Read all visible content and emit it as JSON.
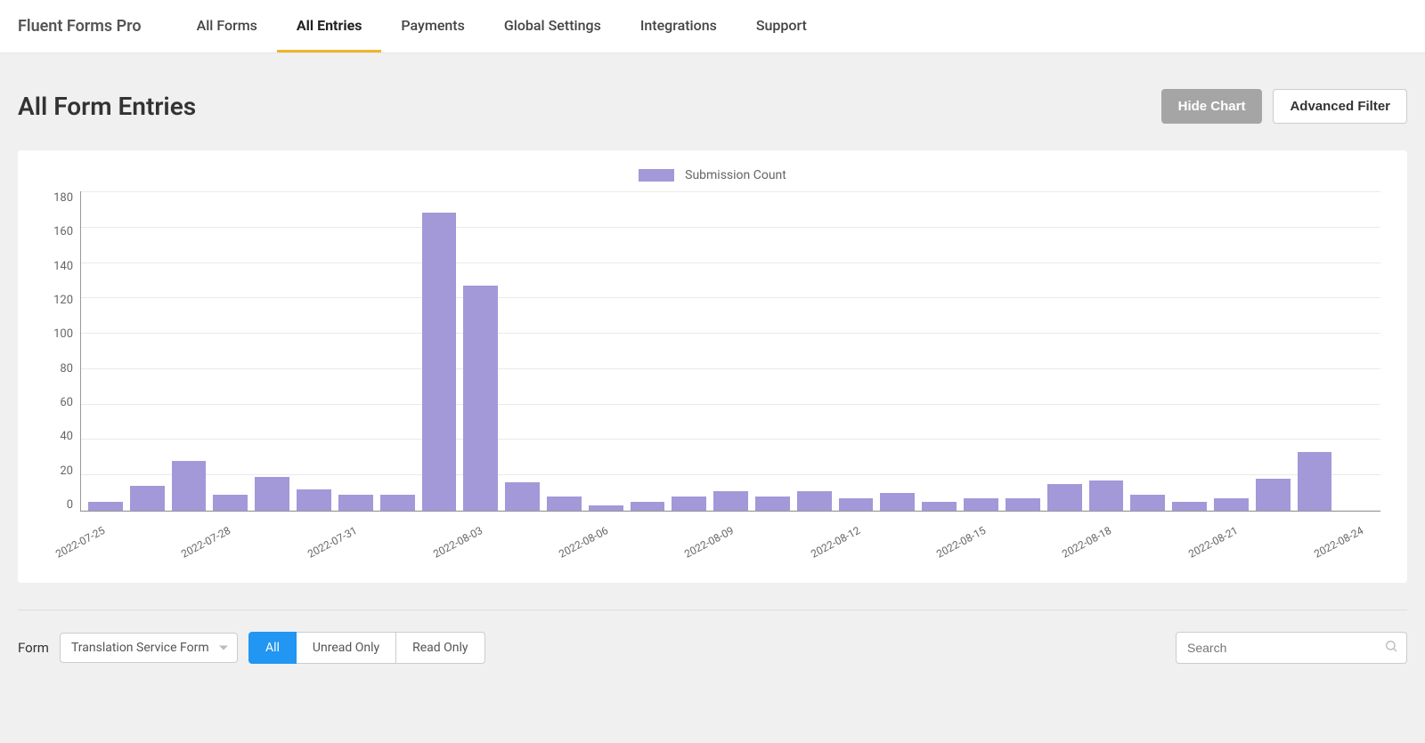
{
  "brand": "Fluent Forms Pro",
  "nav": {
    "items": [
      {
        "label": "All Forms",
        "active": false
      },
      {
        "label": "All Entries",
        "active": true
      },
      {
        "label": "Payments",
        "active": false
      },
      {
        "label": "Global Settings",
        "active": false
      },
      {
        "label": "Integrations",
        "active": false
      },
      {
        "label": "Support",
        "active": false
      }
    ]
  },
  "page_title": "All Form Entries",
  "header_buttons": {
    "hide_chart": "Hide Chart",
    "advanced_filter": "Advanced Filter"
  },
  "legend_label": "Submission Count",
  "chart_data": {
    "type": "bar",
    "title": "",
    "xlabel": "",
    "ylabel": "",
    "ylim": [
      0,
      180
    ],
    "yticks": [
      0,
      20,
      40,
      60,
      80,
      100,
      120,
      140,
      160,
      180
    ],
    "categories": [
      "2022-07-25",
      "2022-07-26",
      "2022-07-27",
      "2022-07-28",
      "2022-07-29",
      "2022-07-30",
      "2022-07-31",
      "2022-08-01",
      "2022-08-02",
      "2022-08-03",
      "2022-08-04",
      "2022-08-05",
      "2022-08-06",
      "2022-08-07",
      "2022-08-08",
      "2022-08-09",
      "2022-08-10",
      "2022-08-11",
      "2022-08-12",
      "2022-08-13",
      "2022-08-14",
      "2022-08-15",
      "2022-08-16",
      "2022-08-17",
      "2022-08-18",
      "2022-08-19",
      "2022-08-20",
      "2022-08-21",
      "2022-08-22",
      "2022-08-23",
      "2022-08-24"
    ],
    "x_tick_labels": [
      "2022-07-25",
      "2022-07-28",
      "2022-07-31",
      "2022-08-03",
      "2022-08-06",
      "2022-08-09",
      "2022-08-12",
      "2022-08-15",
      "2022-08-18",
      "2022-08-21",
      "2022-08-24"
    ],
    "values": [
      5,
      14,
      28,
      9,
      19,
      12,
      9,
      9,
      168,
      127,
      16,
      8,
      3,
      5,
      8,
      11,
      8,
      11,
      7,
      10,
      5,
      7,
      7,
      15,
      17,
      9,
      5,
      7,
      18,
      33,
      0
    ],
    "series_color": "#a398d8",
    "legend": "Submission Count"
  },
  "filters": {
    "form_label": "Form",
    "selected_form": "Translation Service Form",
    "segments": [
      {
        "label": "All",
        "active": true
      },
      {
        "label": "Unread Only",
        "active": false
      },
      {
        "label": "Read Only",
        "active": false
      }
    ],
    "search_placeholder": "Search"
  }
}
